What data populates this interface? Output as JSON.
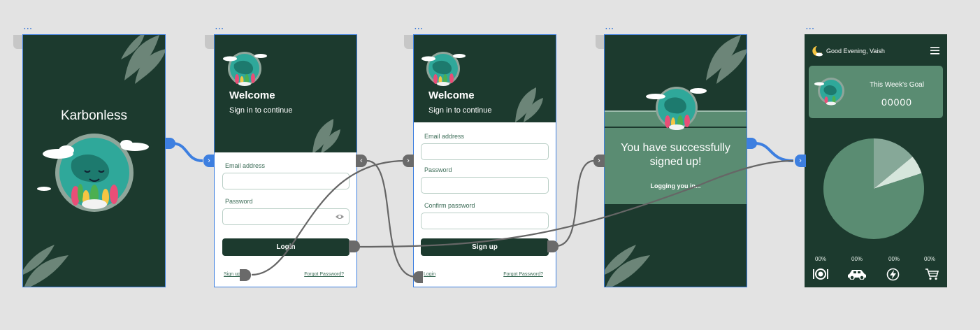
{
  "screen_splash": {
    "app_name": "Karbonless"
  },
  "screen_login": {
    "welcome": "Welcome",
    "subtitle": "Sign in to continue",
    "email_label": "Email address",
    "password_label": "Password",
    "login_button": "Login",
    "signup_link": "Sign up",
    "forgot_link": "Forgot Password?"
  },
  "screen_signup": {
    "welcome": "Welcome",
    "subtitle": "Sign in to continue",
    "email_label": "Email address",
    "password_label": "Password",
    "confirm_label": "Confirm password",
    "signup_button": "Sign up",
    "login_link": "Login",
    "forgot_link": "Forgot Password?"
  },
  "screen_success": {
    "message": "You have successfully signed up!",
    "status": "Logging you in..."
  },
  "screen_dashboard": {
    "greeting": "Good Evening, Vaish",
    "goal_title": "This Week's Goal",
    "goal_value": "00000",
    "categories": [
      {
        "percent": "00%",
        "icon": "food-icon"
      },
      {
        "percent": "00%",
        "icon": "car-icon"
      },
      {
        "percent": "00%",
        "icon": "energy-icon"
      },
      {
        "percent": "00%",
        "icon": "cart-icon"
      }
    ]
  },
  "chart_data": {
    "type": "pie",
    "values": [
      80,
      14,
      6
    ],
    "colors": [
      "#5a8c72",
      "#86a898",
      "#d6e6dc"
    ]
  },
  "colors": {
    "primary": "#1c3a2e",
    "accent": "#5a8c72",
    "selection": "#3d7fe0",
    "canvas": "#e3e3e3"
  }
}
